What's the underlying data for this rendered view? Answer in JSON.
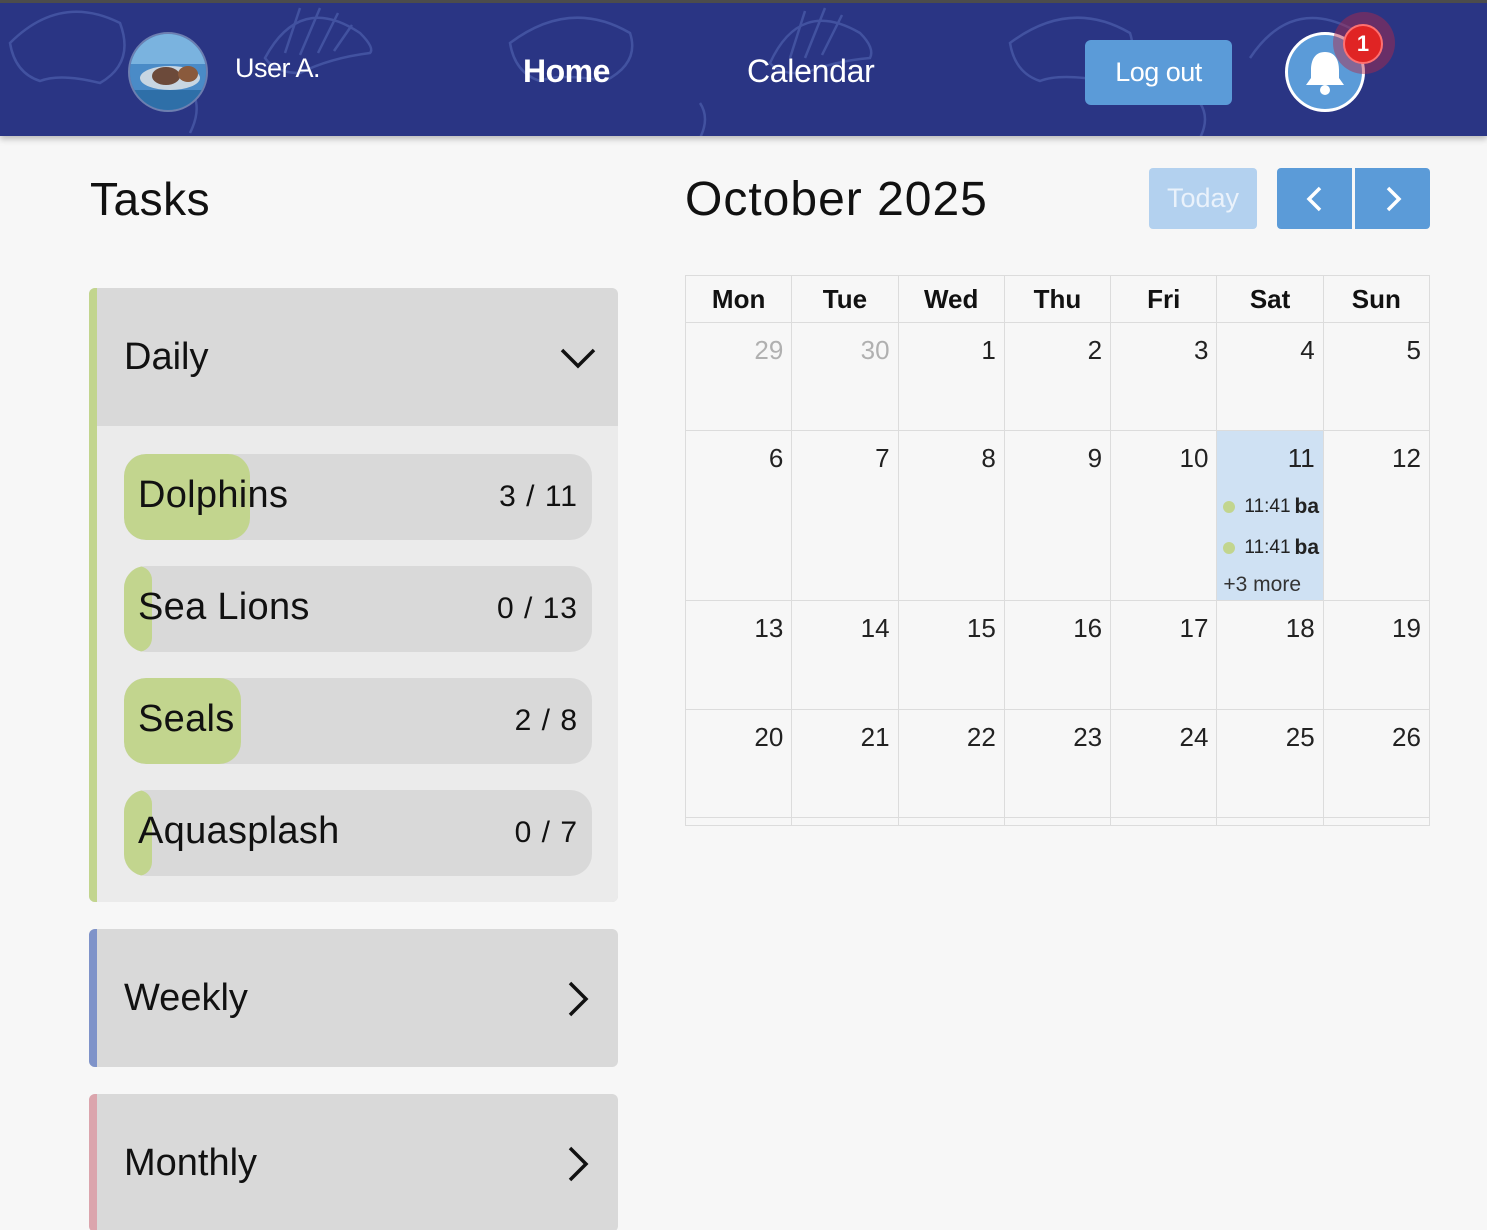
{
  "header": {
    "username": "User A.",
    "nav": {
      "home": "Home",
      "calendar": "Calendar"
    },
    "logout": "Log out",
    "notification_count": "1",
    "colors": {
      "bar": "#2a3584",
      "accent": "#5b9bd8",
      "badge": "#e02424"
    }
  },
  "tasks": {
    "title": "Tasks",
    "groups": {
      "daily": {
        "label": "Daily",
        "color": "#c2d58e",
        "expanded": true,
        "items": [
          {
            "name": "Dolphins",
            "count": "3 / 11",
            "progress": 0.27
          },
          {
            "name": "Sea Lions",
            "count": "0 / 13",
            "progress": 0
          },
          {
            "name": "Seals",
            "count": "2 / 8",
            "progress": 0.25
          },
          {
            "name": "Aquasplash",
            "count": "0 / 7",
            "progress": 0
          }
        ]
      },
      "weekly": {
        "label": "Weekly",
        "color": "#7f93c9",
        "expanded": false
      },
      "monthly": {
        "label": "Monthly",
        "color": "#dba5ad",
        "expanded": false
      }
    }
  },
  "calendar": {
    "month_label": "October 2025",
    "today_label": "Today",
    "weekdays": [
      "Mon",
      "Tue",
      "Wed",
      "Thu",
      "Fri",
      "Sat",
      "Sun"
    ],
    "weeks": [
      [
        "29",
        "30",
        "1",
        "2",
        "3",
        "4",
        "5"
      ],
      [
        "6",
        "7",
        "8",
        "9",
        "10",
        "11",
        "12"
      ],
      [
        "13",
        "14",
        "15",
        "16",
        "17",
        "18",
        "19"
      ],
      [
        "20",
        "21",
        "22",
        "23",
        "24",
        "25",
        "26"
      ]
    ],
    "events": [
      {
        "time": "11:41",
        "title": "ba"
      },
      {
        "time": "11:41",
        "title": "ba"
      }
    ],
    "more": "+3 more"
  }
}
